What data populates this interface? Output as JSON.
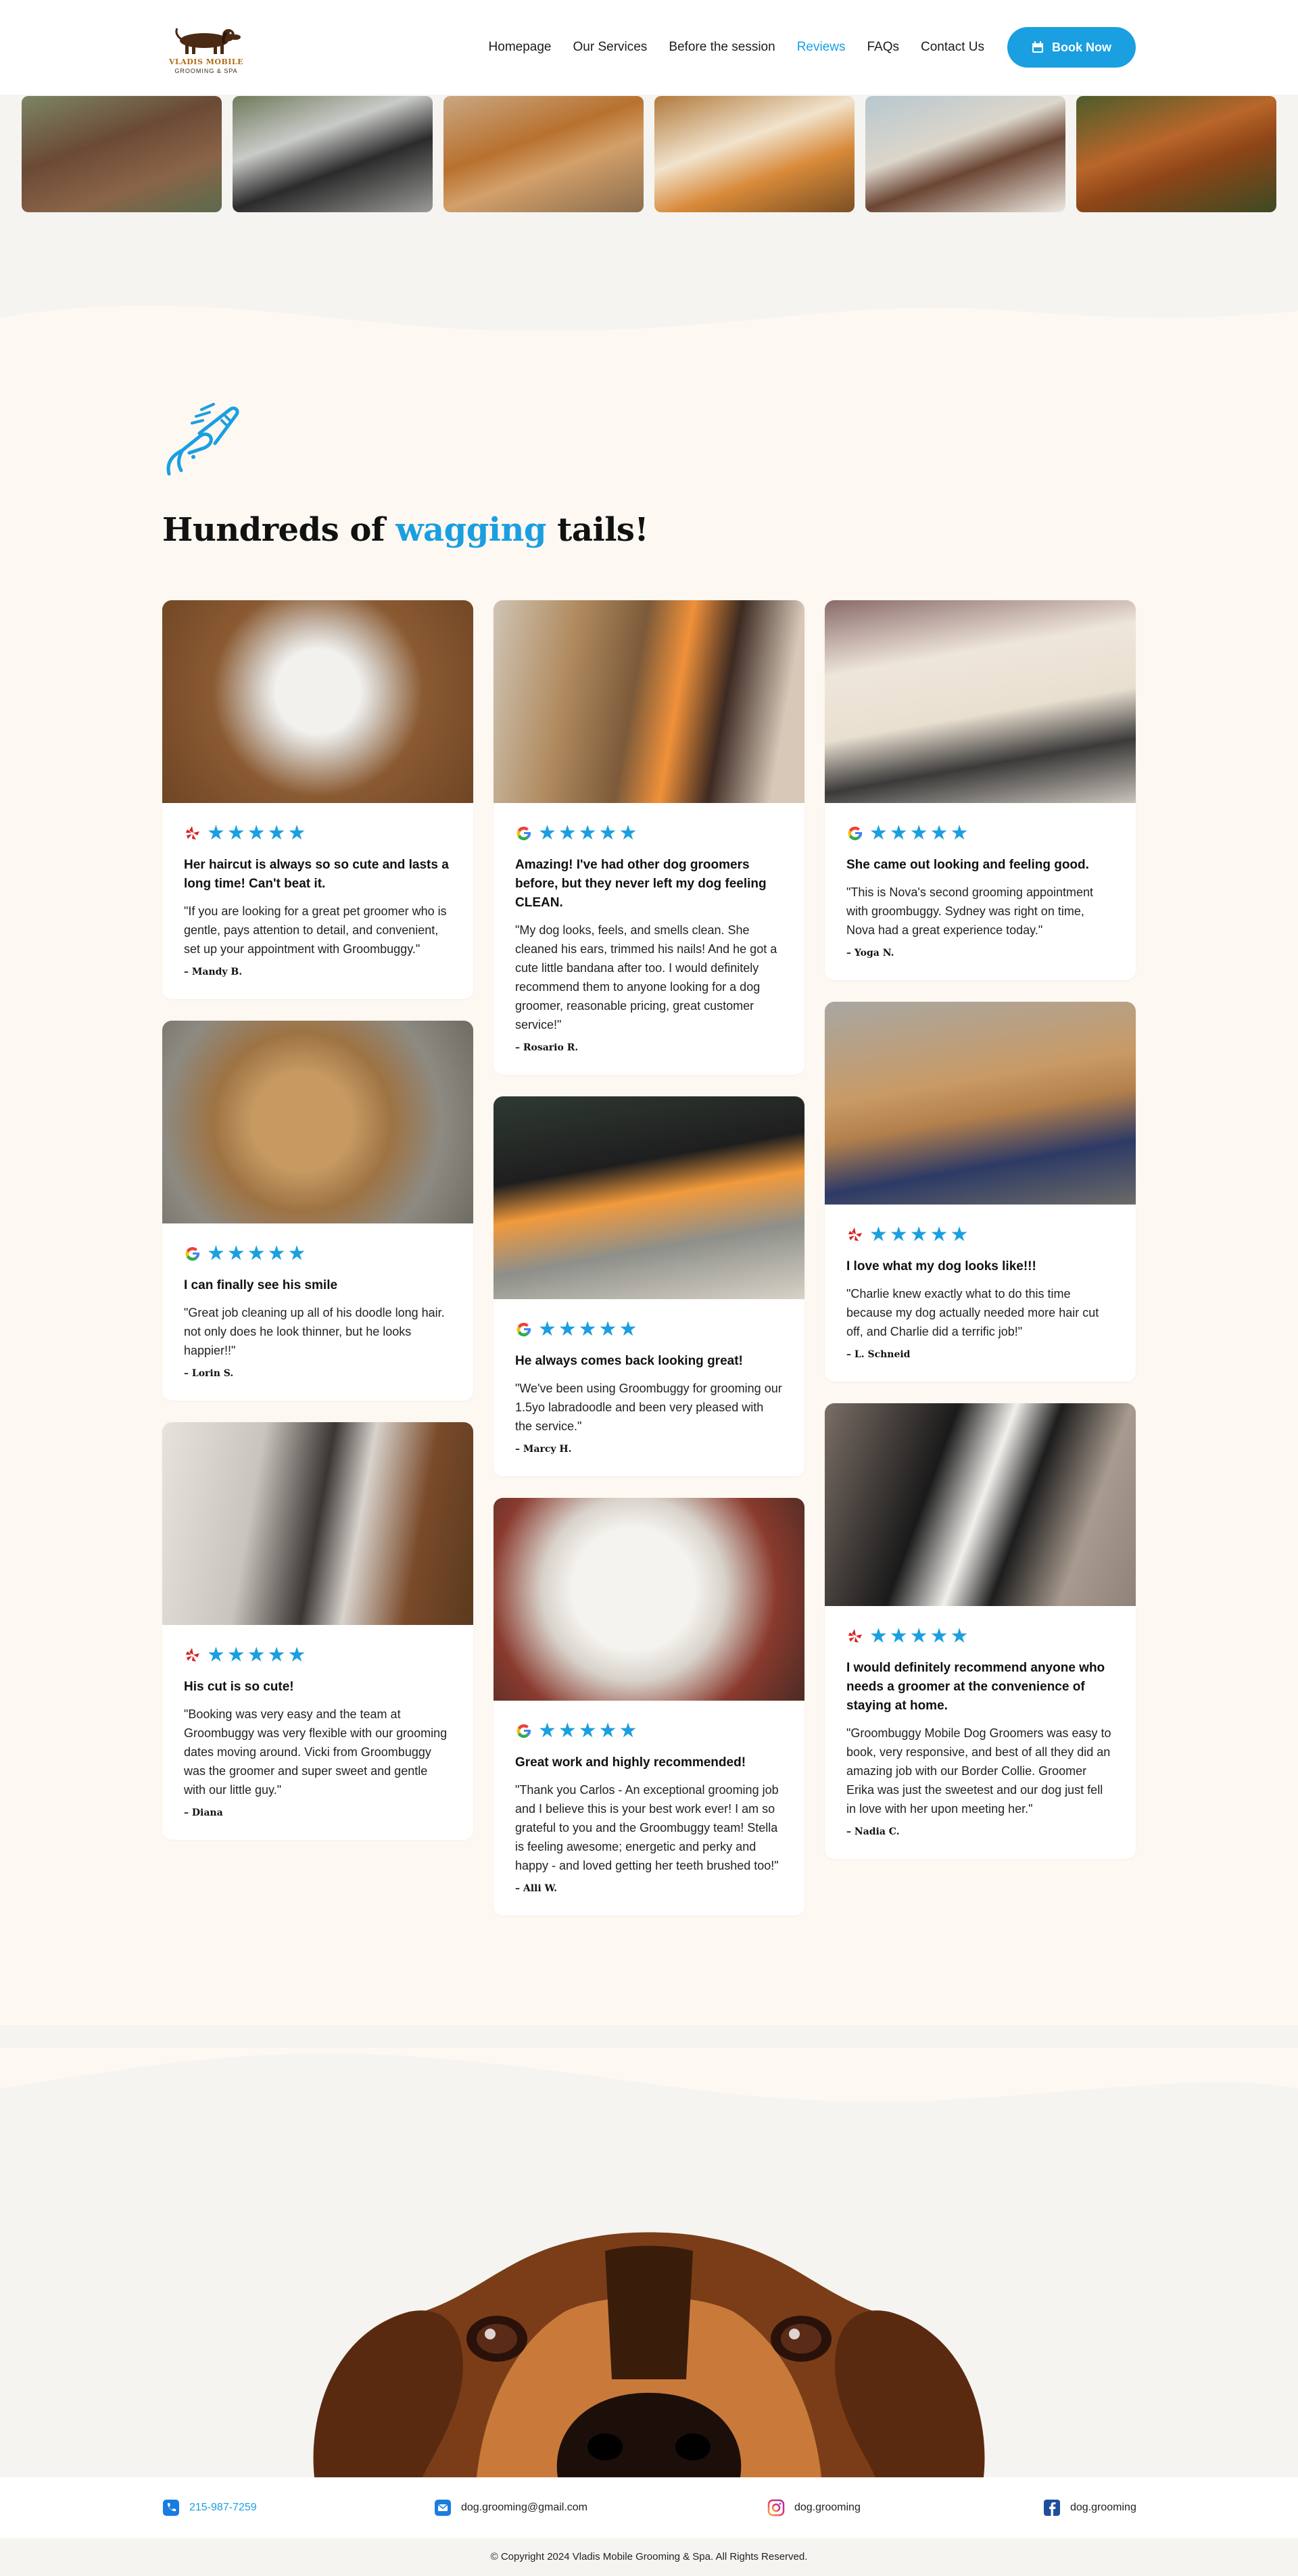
{
  "brand": {
    "name": "VLADIS MOBILE",
    "tagline": "GROOMING & SPA",
    "accent": "#1a9fe0"
  },
  "nav": {
    "items": [
      {
        "label": "Homepage"
      },
      {
        "label": "Our Services"
      },
      {
        "label": "Before the session"
      },
      {
        "label": "Reviews",
        "active": true
      },
      {
        "label": "FAQs"
      },
      {
        "label": "Contact Us"
      }
    ],
    "book_label": "Book Now"
  },
  "strip_photos": [
    "dog-licking",
    "husky-pup",
    "corgi-and-terrier",
    "beagle",
    "collie-mix",
    "retriever"
  ],
  "reviews": {
    "headline_pre": "Hundreds of ",
    "headline_accent": "wagging",
    "headline_post": " tails!",
    "stars": "★★★★★",
    "columns": [
      [
        {
          "source": "yelp",
          "title": "Her haircut is always so so cute and lasts a long time! Can't beat it.",
          "text": "\"If you are looking for a great pet groomer who is gentle, pays attention to detail, and convenient, set up your appointment with Groombuggy.\"",
          "author": "– Mandy B."
        },
        {
          "source": "google",
          "title": "I can finally see his smile",
          "text": "\"Great job cleaning up all of his doodle long hair. not only does he look thinner, but he looks happier!!\"",
          "author": "– Lorin S."
        },
        {
          "source": "yelp",
          "title": "His cut is so cute!",
          "text": "\"Booking was very easy and the team at Groombuggy was very flexible with our grooming dates moving around. Vicki from Groombuggy was the groomer and super sweet and gentle with our little guy.\"",
          "author": "– Diana"
        }
      ],
      [
        {
          "source": "google",
          "title": "Amazing! I've had other dog groomers before, but they never left my dog feeling CLEAN.",
          "text": "\"My dog looks, feels, and smells clean. She cleaned his ears, trimmed his nails! And he got a cute little bandana after too. I would definitely recommend them to anyone looking for a dog groomer, reasonable pricing, great customer service!\"",
          "author": "– Rosario R."
        },
        {
          "source": "google",
          "title": "He always comes back looking great!",
          "text": "\"We've been using Groombuggy for grooming our 1.5yo labradoodle and been very pleased with the service.\"",
          "author": "– Marcy H."
        },
        {
          "source": "google",
          "title": "Great work and highly recommended!",
          "text": "\"Thank you Carlos - An exceptional grooming job and I believe this is your best work ever! I am so grateful to you and the Groombuggy team! Stella is feeling awesome; energetic and perky and happy - and loved getting her teeth brushed too!\"",
          "author": "– Alli W."
        }
      ],
      [
        {
          "source": "google",
          "title": "She came out looking and feeling good.",
          "text": "\"This is Nova's second grooming appointment with groombuggy. Sydney was right on time, Nova had a great experience today.\"",
          "author": "– Yoga N."
        },
        {
          "source": "yelp",
          "title": "I love what my dog looks like!!!",
          "text": "\"Charlie knew exactly what to do this time because my dog actually needed more hair cut off, and Charlie did a terrific job!\"",
          "author": "– L. Schneid"
        },
        {
          "source": "yelp",
          "title": "I would definitely recommend anyone who needs a groomer at the convenience of staying at home.",
          "text": "\"Groombuggy Mobile Dog Groomers was easy to book, very responsive, and best of all they did an amazing job with our Border Collie. Groomer Erika was just the sweetest and our dog just fell in love with her upon meeting her.\"",
          "author": "– Nadia C."
        }
      ]
    ]
  },
  "footer": {
    "phone": "215-987-7259",
    "email": "dog.grooming@gmail.com",
    "instagram": "dog.grooming",
    "facebook": "dog.grooming",
    "copyright": "© Copyright 2024 Vladis Mobile Grooming & Spa. All Rights Reserved."
  }
}
